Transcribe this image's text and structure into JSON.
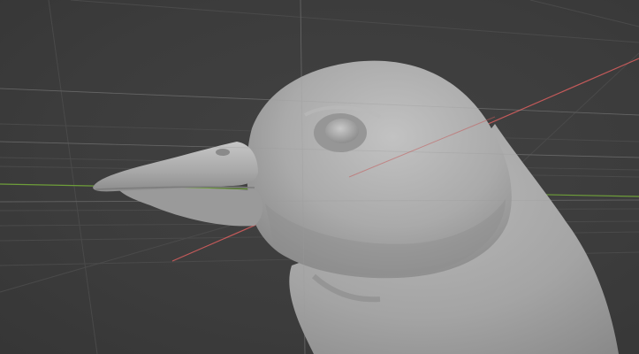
{
  "viewport": {
    "background_color": "#3d3d3d",
    "grid_color": "#4a4a4a",
    "x_axis_color": "#c45a5a",
    "y_axis_color": "#6e9e3a",
    "model_color": "#a9a9a9",
    "grid_visible": true
  },
  "model": {
    "icon": "penguin-head-sculpt"
  }
}
